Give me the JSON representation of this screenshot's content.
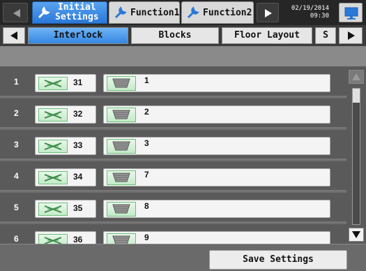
{
  "topbar": {
    "tabs": [
      {
        "label": "Initial Settings",
        "line1": "Initial",
        "line2": "Settings",
        "icon": "wrench-icon",
        "active": true
      },
      {
        "label": "Function1",
        "icon": "wrench-icon",
        "active": false
      },
      {
        "label": "Function2",
        "icon": "wrench-icon",
        "active": false
      }
    ],
    "date": "02/19/2014",
    "time": "09:30"
  },
  "subtabs": {
    "items": [
      "Interlock",
      "Blocks",
      "Floor Layout",
      "S"
    ],
    "active": "Interlock"
  },
  "rows": [
    {
      "index": "1",
      "interface_no": "31",
      "unit_no": "1"
    },
    {
      "index": "2",
      "interface_no": "32",
      "unit_no": "2"
    },
    {
      "index": "3",
      "interface_no": "33",
      "unit_no": "3"
    },
    {
      "index": "4",
      "interface_no": "34",
      "unit_no": "7"
    },
    {
      "index": "5",
      "interface_no": "35",
      "unit_no": "8"
    },
    {
      "index": "6",
      "interface_no": "36",
      "unit_no": "9"
    }
  ],
  "buttons": {
    "save_label": "Save Settings"
  },
  "colors": {
    "active_tab": "#2a78d8",
    "icon_green": "#6bbf76",
    "background": "#5a5a5a"
  }
}
